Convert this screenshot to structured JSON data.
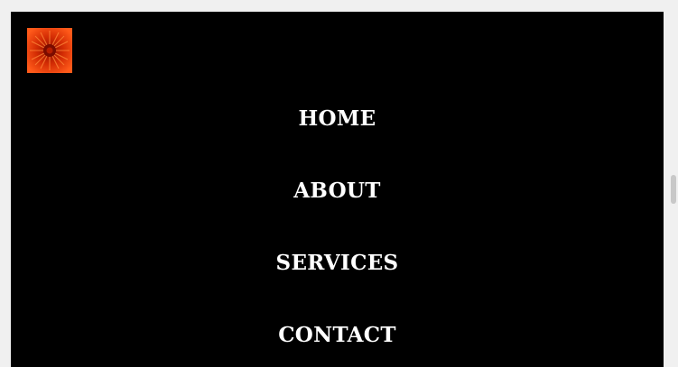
{
  "logo": {
    "icon": "flower-icon",
    "colors": [
      "#ff4a10",
      "#d62800",
      "#9c1200"
    ]
  },
  "nav": {
    "items": [
      {
        "label": "HOME"
      },
      {
        "label": "ABOUT"
      },
      {
        "label": "SERVICES"
      },
      {
        "label": "CONTACT"
      }
    ]
  },
  "colors": {
    "background": "#000000",
    "text": "#ffffff",
    "window": "#f0f0f0"
  }
}
